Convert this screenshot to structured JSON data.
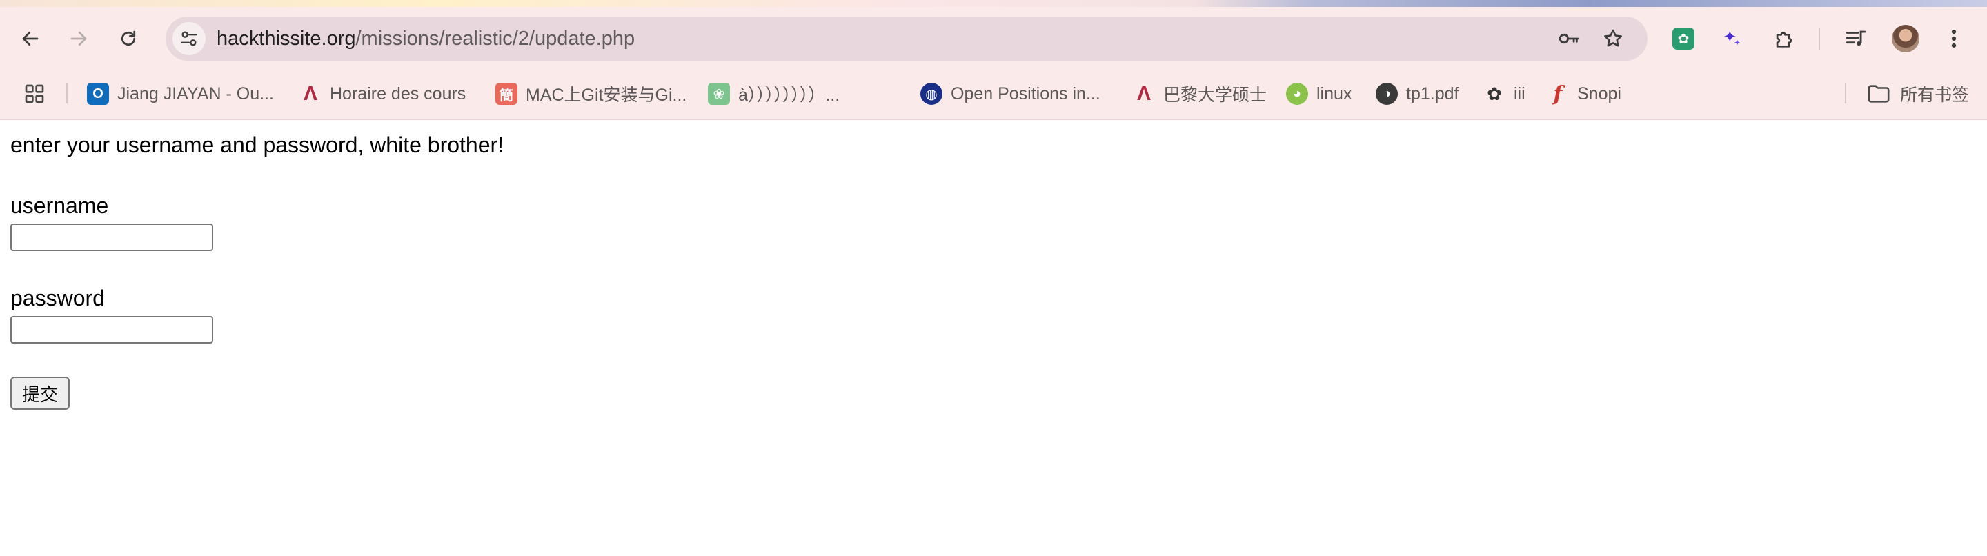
{
  "browser": {
    "address": {
      "host": "hackthissite.org",
      "path": "/missions/realistic/2/update.php"
    },
    "bookmarks": [
      {
        "label": "Jiang JIAYAN - Ou...",
        "icon": "outlook-icon",
        "color": "#0f6cbd",
        "glyph": "O"
      },
      {
        "label": "Horaire des cours",
        "icon": "university-logo-icon",
        "color": "#b1283f",
        "glyph": "Ʌ"
      },
      {
        "label": "MAC上Git安装与Gi...",
        "icon": "jianshu-icon",
        "color": "#e9685a",
        "glyph": "簡"
      },
      {
        "label": "à））））））））...",
        "icon": "paw-icon",
        "color": "#7ec48f",
        "glyph": "❀"
      },
      {
        "label": "Open Positions in...",
        "icon": "globe-icon",
        "color": "#1a2f8a",
        "glyph": "◍"
      },
      {
        "label": "巴黎大学硕士",
        "icon": "university-logo-icon",
        "color": "#b1283f",
        "glyph": "Ʌ"
      },
      {
        "label": "linux",
        "icon": "penguin-icon",
        "color": "#8bc34a",
        "glyph": "◕"
      },
      {
        "label": "tp1.pdf",
        "icon": "world-icon",
        "color": "#3a3a3a",
        "glyph": "◑"
      },
      {
        "label": "iii",
        "icon": "openai-icon",
        "color": "#ffffff",
        "glyph": "✿"
      },
      {
        "label": "Snopi",
        "icon": "snopi-icon",
        "color": "#ffffff",
        "glyph": "f"
      }
    ],
    "all_bookmarks_label": "所有书签"
  },
  "page": {
    "intro": "enter your username and password, white brother!",
    "username_label": "username",
    "password_label": "password",
    "submit_label": "提交"
  }
}
